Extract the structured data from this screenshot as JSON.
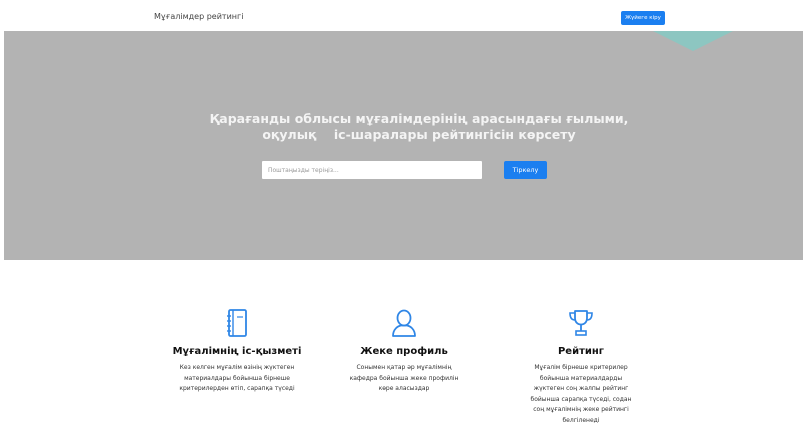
{
  "header": {
    "brand": "Мұғалімдер рейтингі",
    "login_label": "Жүйеге кіру"
  },
  "hero": {
    "title_line1": "Қарағанды облысы мұғалімдерінің арасындағы ғылыми,",
    "title_line2": "оқулық    іс-шаралары рейтингісін көрсету",
    "email_placeholder": "Поштаңызды теріңіз...",
    "signup_label": "Тіркелу"
  },
  "features": [
    {
      "icon": "notebook-icon",
      "title": "Мұғалімнің іс-қызметі",
      "text": "Кез келген мұғалім өзінің жүктеген материалдары бойынша бірнеше критерилерден өтіп, сарапқа түседі"
    },
    {
      "icon": "user-icon",
      "title": "Жеке профиль",
      "text": "Сонымен қатар әр мұғалімнің кафедра бойынша жеке профилін көре аласыздар"
    },
    {
      "icon": "trophy-icon",
      "title": "Рейтинг",
      "text": "Мұғалім бірнеше критерилер бойынша материалдарды жүктеген соң жалпы рейтинг бойынша сарапқа түседі, содан соң мұғалімнің жеке рейтингі белгіленеді"
    }
  ],
  "colors": {
    "accent": "#1b7ff0",
    "hero_bg": "#b3b3b3",
    "icon": "#2f86e6"
  }
}
